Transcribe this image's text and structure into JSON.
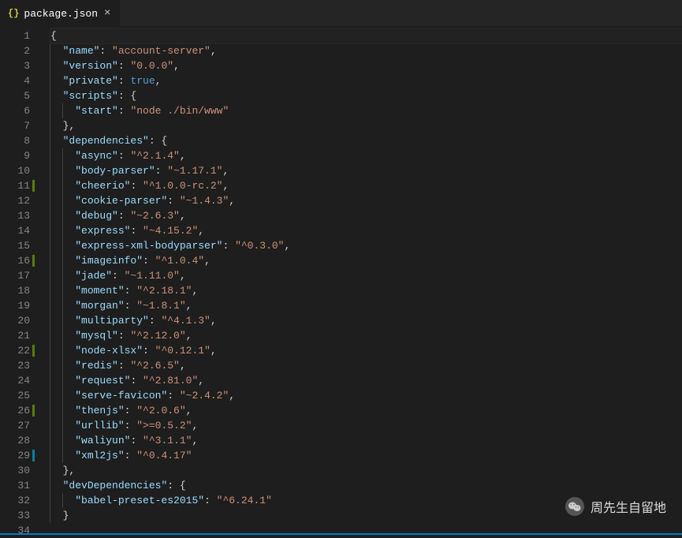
{
  "tab": {
    "label": "package.json",
    "icon": "{}"
  },
  "watermark": "周先生自留地",
  "gutter_markers": {
    "11": "modified",
    "16": "modified",
    "22": "modified",
    "26": "modified",
    "29": "added"
  },
  "code": [
    [
      0,
      [
        [
          "j-punc",
          "{"
        ]
      ]
    ],
    [
      1,
      [
        [
          "j-key",
          "\"name\""
        ],
        [
          "j-punc",
          ": "
        ],
        [
          "j-str",
          "\"account-server\""
        ],
        [
          "j-punc",
          ","
        ]
      ]
    ],
    [
      1,
      [
        [
          "j-key",
          "\"version\""
        ],
        [
          "j-punc",
          ": "
        ],
        [
          "j-str",
          "\"0.0.0\""
        ],
        [
          "j-punc",
          ","
        ]
      ]
    ],
    [
      1,
      [
        [
          "j-key",
          "\"private\""
        ],
        [
          "j-punc",
          ": "
        ],
        [
          "j-bool",
          "true"
        ],
        [
          "j-punc",
          ","
        ]
      ]
    ],
    [
      1,
      [
        [
          "j-key",
          "\"scripts\""
        ],
        [
          "j-punc",
          ": {"
        ]
      ]
    ],
    [
      2,
      [
        [
          "j-key",
          "\"start\""
        ],
        [
          "j-punc",
          ": "
        ],
        [
          "j-str",
          "\"node ./bin/www\""
        ]
      ]
    ],
    [
      1,
      [
        [
          "j-punc",
          "},"
        ]
      ]
    ],
    [
      1,
      [
        [
          "j-key",
          "\"dependencies\""
        ],
        [
          "j-punc",
          ": {"
        ]
      ]
    ],
    [
      2,
      [
        [
          "j-key",
          "\"async\""
        ],
        [
          "j-punc",
          ": "
        ],
        [
          "j-str",
          "\"^2.1.4\""
        ],
        [
          "j-punc",
          ","
        ]
      ]
    ],
    [
      2,
      [
        [
          "j-key",
          "\"body-parser\""
        ],
        [
          "j-punc",
          ": "
        ],
        [
          "j-str",
          "\"~1.17.1\""
        ],
        [
          "j-punc",
          ","
        ]
      ]
    ],
    [
      2,
      [
        [
          "j-key",
          "\"cheerio\""
        ],
        [
          "j-punc",
          ": "
        ],
        [
          "j-str",
          "\"^1.0.0-rc.2\""
        ],
        [
          "j-punc",
          ","
        ]
      ]
    ],
    [
      2,
      [
        [
          "j-key",
          "\"cookie-parser\""
        ],
        [
          "j-punc",
          ": "
        ],
        [
          "j-str",
          "\"~1.4.3\""
        ],
        [
          "j-punc",
          ","
        ]
      ]
    ],
    [
      2,
      [
        [
          "j-key",
          "\"debug\""
        ],
        [
          "j-punc",
          ": "
        ],
        [
          "j-str",
          "\"~2.6.3\""
        ],
        [
          "j-punc",
          ","
        ]
      ]
    ],
    [
      2,
      [
        [
          "j-key",
          "\"express\""
        ],
        [
          "j-punc",
          ": "
        ],
        [
          "j-str",
          "\"~4.15.2\""
        ],
        [
          "j-punc",
          ","
        ]
      ]
    ],
    [
      2,
      [
        [
          "j-key",
          "\"express-xml-bodyparser\""
        ],
        [
          "j-punc",
          ": "
        ],
        [
          "j-str",
          "\"^0.3.0\""
        ],
        [
          "j-punc",
          ","
        ]
      ]
    ],
    [
      2,
      [
        [
          "j-key",
          "\"imageinfo\""
        ],
        [
          "j-punc",
          ": "
        ],
        [
          "j-str",
          "\"^1.0.4\""
        ],
        [
          "j-punc",
          ","
        ]
      ]
    ],
    [
      2,
      [
        [
          "j-key",
          "\"jade\""
        ],
        [
          "j-punc",
          ": "
        ],
        [
          "j-str",
          "\"~1.11.0\""
        ],
        [
          "j-punc",
          ","
        ]
      ]
    ],
    [
      2,
      [
        [
          "j-key",
          "\"moment\""
        ],
        [
          "j-punc",
          ": "
        ],
        [
          "j-str",
          "\"^2.18.1\""
        ],
        [
          "j-punc",
          ","
        ]
      ]
    ],
    [
      2,
      [
        [
          "j-key",
          "\"morgan\""
        ],
        [
          "j-punc",
          ": "
        ],
        [
          "j-str",
          "\"~1.8.1\""
        ],
        [
          "j-punc",
          ","
        ]
      ]
    ],
    [
      2,
      [
        [
          "j-key",
          "\"multiparty\""
        ],
        [
          "j-punc",
          ": "
        ],
        [
          "j-str",
          "\"^4.1.3\""
        ],
        [
          "j-punc",
          ","
        ]
      ]
    ],
    [
      2,
      [
        [
          "j-key",
          "\"mysql\""
        ],
        [
          "j-punc",
          ": "
        ],
        [
          "j-str",
          "\"^2.12.0\""
        ],
        [
          "j-punc",
          ","
        ]
      ]
    ],
    [
      2,
      [
        [
          "j-key",
          "\"node-xlsx\""
        ],
        [
          "j-punc",
          ": "
        ],
        [
          "j-str",
          "\"^0.12.1\""
        ],
        [
          "j-punc",
          ","
        ]
      ]
    ],
    [
      2,
      [
        [
          "j-key",
          "\"redis\""
        ],
        [
          "j-punc",
          ": "
        ],
        [
          "j-str",
          "\"^2.6.5\""
        ],
        [
          "j-punc",
          ","
        ]
      ]
    ],
    [
      2,
      [
        [
          "j-key",
          "\"request\""
        ],
        [
          "j-punc",
          ": "
        ],
        [
          "j-str",
          "\"^2.81.0\""
        ],
        [
          "j-punc",
          ","
        ]
      ]
    ],
    [
      2,
      [
        [
          "j-key",
          "\"serve-favicon\""
        ],
        [
          "j-punc",
          ": "
        ],
        [
          "j-str",
          "\"~2.4.2\""
        ],
        [
          "j-punc",
          ","
        ]
      ]
    ],
    [
      2,
      [
        [
          "j-key",
          "\"thenjs\""
        ],
        [
          "j-punc",
          ": "
        ],
        [
          "j-str",
          "\"^2.0.6\""
        ],
        [
          "j-punc",
          ","
        ]
      ]
    ],
    [
      2,
      [
        [
          "j-key",
          "\"urllib\""
        ],
        [
          "j-punc",
          ": "
        ],
        [
          "j-str",
          "\">=0.5.2\""
        ],
        [
          "j-punc",
          ","
        ]
      ]
    ],
    [
      2,
      [
        [
          "j-key",
          "\"waliyun\""
        ],
        [
          "j-punc",
          ": "
        ],
        [
          "j-str",
          "\"^3.1.1\""
        ],
        [
          "j-punc",
          ","
        ]
      ]
    ],
    [
      2,
      [
        [
          "j-key",
          "\"xml2js\""
        ],
        [
          "j-punc",
          ": "
        ],
        [
          "j-str",
          "\"^0.4.17\""
        ]
      ]
    ],
    [
      1,
      [
        [
          "j-punc",
          "},"
        ]
      ]
    ],
    [
      1,
      [
        [
          "j-key",
          "\"devDependencies\""
        ],
        [
          "j-punc",
          ": {"
        ]
      ]
    ],
    [
      2,
      [
        [
          "j-key",
          "\"babel-preset-es2015\""
        ],
        [
          "j-punc",
          ": "
        ],
        [
          "j-str",
          "\"^6.24.1\""
        ]
      ]
    ],
    [
      1,
      [
        [
          "j-punc",
          "}"
        ]
      ]
    ],
    [
      0,
      [
        [
          "j-punc",
          ""
        ]
      ]
    ]
  ]
}
